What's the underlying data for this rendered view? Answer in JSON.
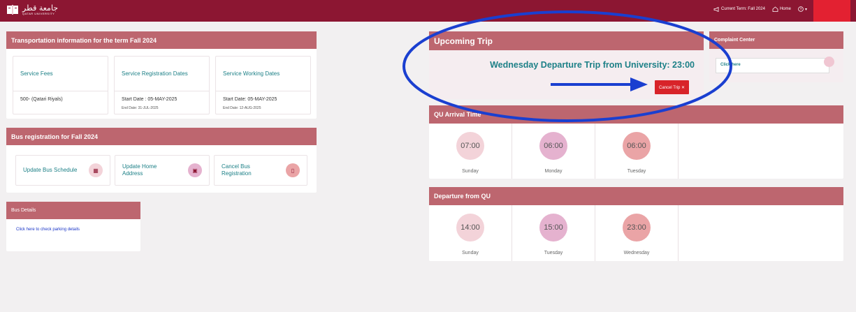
{
  "header": {
    "logo_ar": "جامعة قطر",
    "logo_en": "QATAR UNIVERSITY",
    "current_term": "Current Term: Fall 2024",
    "home": "Home",
    "help_icon": "help-icon"
  },
  "transport": {
    "title": "Transportation information for the term Fall 2024",
    "fees": {
      "label": "Service Fees",
      "value": "500- (Qatari Riyals)"
    },
    "registration": {
      "label": "Service Registration Dates",
      "start": "Start Date : 05-MAY-2025",
      "end": "End Date: 31-JUL-2025"
    },
    "working": {
      "label": "Service Working Dates",
      "start": "Start Date: 05-MAY-2025",
      "end": "End Date: 12-AUG-2025"
    }
  },
  "bus_registration": {
    "title": "Bus registration for Fall 2024",
    "actions": [
      {
        "label": "Update Bus Schedule",
        "icon": "calendar-icon",
        "color": "#f3d3d9"
      },
      {
        "label": "Update Home Address",
        "icon": "address-icon",
        "color": "#e5b2cf"
      },
      {
        "label": "Cancel Bus Registration",
        "icon": "cancel-document-icon",
        "color": "#eaa4a6"
      }
    ]
  },
  "bus_details": {
    "title": "Bus Details",
    "link": "Click here to check parking details"
  },
  "upcoming": {
    "title": "Upcoming Trip",
    "trip": "Wednesday Departure Trip from University: 23:00",
    "cancel": "Cancel Trip ✕"
  },
  "complaint": {
    "title": "Complaint Center",
    "link": "Click here"
  },
  "arrival": {
    "title": "QU Arrival Time",
    "items": [
      {
        "time": "07:00",
        "day": "Sunday",
        "color": "#f3d3d9"
      },
      {
        "time": "06:00",
        "day": "Monday",
        "color": "#e5b2cf"
      },
      {
        "time": "06:00",
        "day": "Tuesday",
        "color": "#eaa4a6"
      }
    ]
  },
  "departure": {
    "title": "Departure from QU",
    "items": [
      {
        "time": "14:00",
        "day": "Sunday",
        "color": "#f3d3d9"
      },
      {
        "time": "15:00",
        "day": "Tuesday",
        "color": "#e5b2cf"
      },
      {
        "time": "23:00",
        "day": "Wednesday",
        "color": "#eaa4a6"
      }
    ]
  },
  "annotation": {
    "color": "#1a3fd0"
  }
}
